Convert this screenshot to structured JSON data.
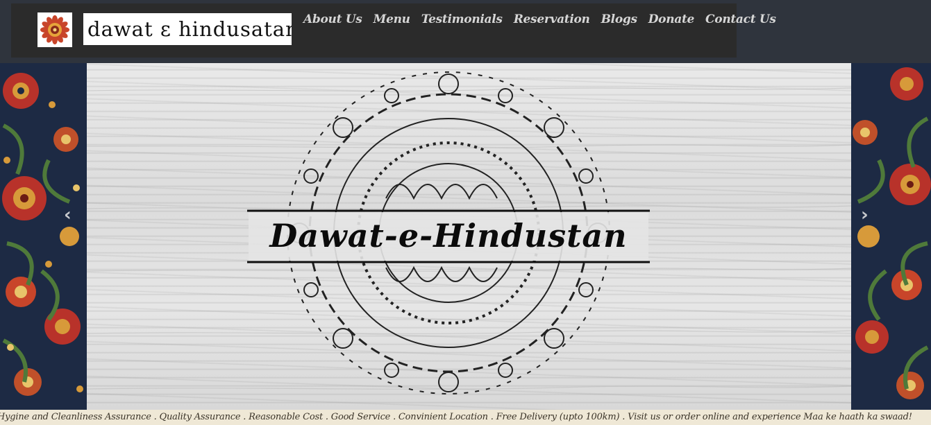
{
  "header": {
    "logo_wordmark": "dawat  ε  hindusatan",
    "logo_emblem_icon": "mandala-flower-icon",
    "nav": [
      "About Us",
      "Menu",
      "Testimonials",
      "Reservation",
      "Blogs",
      "Donate",
      "Contact Us"
    ]
  },
  "hero": {
    "title": "Dawat-e-Hindustan",
    "prev_icon": "chevron-left-icon",
    "next_icon": "chevron-right-icon",
    "prev_glyph": "‹",
    "next_glyph": "›"
  },
  "ticker": {
    "text": "Hygine and Cleanliness Assurance . Quality Assurance . Reasonable Cost . Good Service . Convinient Location . Free Delivery (upto 100km) . Visit us or order online and experience Maa ke haath ka swaad!"
  },
  "colors": {
    "page_bg": "#2f343d",
    "nav_panel": "#2b2b2b",
    "nav_text": "#d6d6d6",
    "ticker_bg": "#efe8d6",
    "pattern_navy": "#1d2a44",
    "pattern_red": "#b8322a",
    "pattern_gold": "#d79a3a"
  }
}
